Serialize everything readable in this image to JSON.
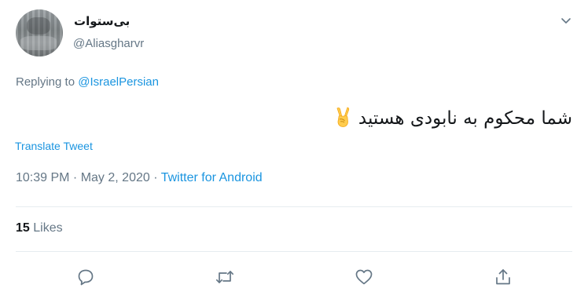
{
  "author": {
    "display_name": "بی‌ستوات",
    "handle": "@Aliasgharvr"
  },
  "reply": {
    "prefix": "Replying to ",
    "mention": "@IsraelPersian"
  },
  "tweet": {
    "text": "شما محکوم به نابودی هستید",
    "emoji": "victory-hand-emoji"
  },
  "translate_label": "Translate Tweet",
  "meta": {
    "time": "10:39 PM",
    "sep1": " · ",
    "date": "May 2, 2020",
    "sep2": " · ",
    "source": "Twitter for Android"
  },
  "stats": {
    "likes_count": "15",
    "likes_label": "Likes"
  },
  "colors": {
    "link": "#1b95e0",
    "muted": "#657786",
    "text": "#14171a",
    "divider": "#e6ecf0"
  },
  "icons": {
    "caret": "chevron-down-icon",
    "reply": "reply-icon",
    "retweet": "retweet-icon",
    "like": "heart-icon",
    "share": "share-icon"
  }
}
